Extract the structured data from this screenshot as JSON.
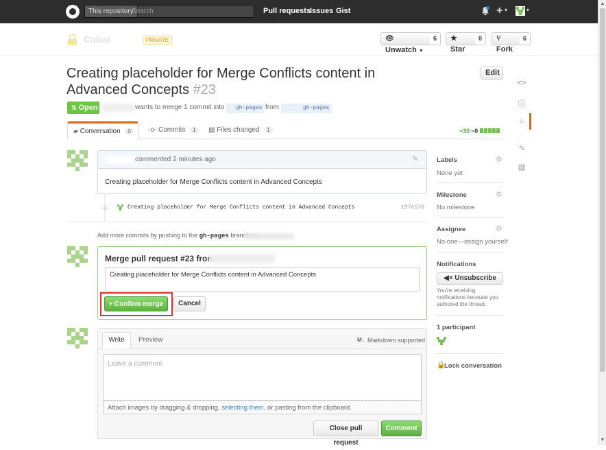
{
  "header": {
    "search_scope": "This repository",
    "search_placeholder": "Search",
    "nav": [
      "Pull requests",
      "Issues",
      "Gist"
    ],
    "plus_label": "+",
    "caret": "▾"
  },
  "repo": {
    "name": "Cubat",
    "private_label": "PRIVATE",
    "unwatch_label": "Unwatch",
    "unwatch_count": "6",
    "star_label": "Star",
    "star_count": "0",
    "fork_label": "Fork",
    "fork_count": "6"
  },
  "pr": {
    "title": "Creating placeholder for Merge Conflicts content in Advanced Concepts",
    "number": "#23",
    "edit_label": "Edit",
    "state_label": "Open",
    "merge_text": "wants to merge 1 commit into",
    "base_branch": "gh-pages",
    "from_text": "from",
    "head_branch": "gh-pages"
  },
  "tabs": [
    {
      "label": "Conversation",
      "count": "0"
    },
    {
      "label": "Commits",
      "count": "1"
    },
    {
      "label": "Files changed",
      "count": "1"
    }
  ],
  "diffstat": {
    "added": "+30",
    "removed": "−0"
  },
  "comment": {
    "meta": "commented 2 minutes ago",
    "body": "Creating placeholder for Merge Conflicts content in Advanced Concepts"
  },
  "commit": {
    "message": "Creating placeholder for Merge Conflicts content in Advanced Concepts",
    "sha": "197e576"
  },
  "push_hint": {
    "text": "Add more commits by pushing to the",
    "branch": "gh-pages",
    "suffix": "branch on"
  },
  "merge": {
    "heading": "Merge pull request #23 from",
    "message": "Creating placeholder for Merge Conflicts content in Advanced Concepts",
    "confirm_label": "Confirm merge",
    "cancel_label": "Cancel"
  },
  "new_comment": {
    "write_tab": "Write",
    "preview_tab": "Preview",
    "markdown_label": "Markdown supported",
    "placeholder": "Leave a comment",
    "attach_text_1": "Attach images by dragging & dropping,",
    "attach_link": "selecting them",
    "attach_text_2": ", or pasting from the clipboard.",
    "close_label": "Close pull request",
    "comment_label": "Comment"
  },
  "sidebar": {
    "labels_title": "Labels",
    "labels_value": "None yet",
    "milestone_title": "Milestone",
    "milestone_value": "No milestone",
    "assignee_title": "Assignee",
    "assignee_value": "No one—assign yourself",
    "notifications_title": "Notifications",
    "unsubscribe_label": "Unsubscribe",
    "notif_reason": "You're receiving notifications because you authored the thread.",
    "participants_title": "1 participant",
    "lock_label": "Lock conversation"
  },
  "colors": {
    "header_bg": "#2d2d2d",
    "open_green": "#6cc644",
    "tab_accent": "#d26911",
    "merge_border": "#95c97e",
    "highlight_red": "#d33333"
  }
}
